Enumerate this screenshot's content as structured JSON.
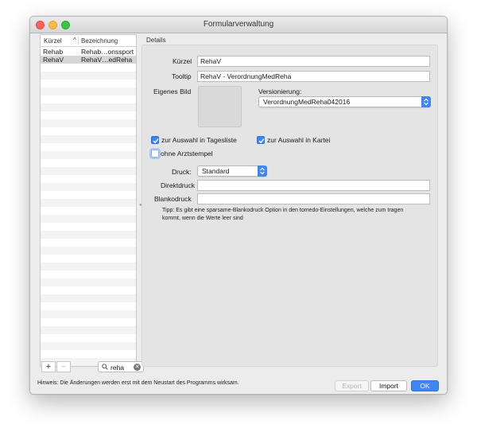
{
  "window": {
    "title": "Formularverwaltung"
  },
  "list": {
    "columns": [
      "Kürzel",
      "Bezeichnung"
    ],
    "sort_indicator": "^",
    "rows": [
      {
        "kuerzel": "Rehab",
        "bezeichnung": "Rehab…onssport"
      },
      {
        "kuerzel": "RehaV",
        "bezeichnung": "RehaV…edReha"
      }
    ],
    "add_label": "+",
    "remove_label": "−",
    "search_value": "reha"
  },
  "details": {
    "section_label": "Details",
    "kuerzel_label": "Kürzel",
    "kuerzel_value": "RehaV",
    "tooltip_label": "Tooltip",
    "tooltip_value": "RehaV - VerordnungMedReha",
    "bild_label": "Eigenes Bild",
    "versionierung_label": "Versionierung:",
    "versionierung_value": "VerordnungMedReha042016",
    "chk_tagesliste_label": "zur Auswahl in Tagesliste",
    "chk_kartei_label": "zur Auswahl in Kartei",
    "chk_arztstempel_label": "ohne Arztstempel",
    "druck_label": "Druck:",
    "druck_value": "Standard",
    "direktdruck_label": "Direktdruck",
    "direktdruck_value": "",
    "blankodruck_label": "Blankodruck",
    "blankodruck_value": "",
    "tip": "Tipp: Es gibt eine sparsame-Blankodruck Option in den tomedo-Einstellungen, welche zum tragen kommt, wenn die  Werte leer sind"
  },
  "footer": {
    "hint": "Hinweis: Die Änderungen werden erst mit dem Neustart des Programms wirksam.",
    "export_label": "Export",
    "import_label": "Import",
    "ok_label": "OK"
  },
  "checkboxes": {
    "tagesliste": true,
    "kartei": true,
    "arztstempel": false
  },
  "colors": {
    "accent": "#3f86f5"
  }
}
